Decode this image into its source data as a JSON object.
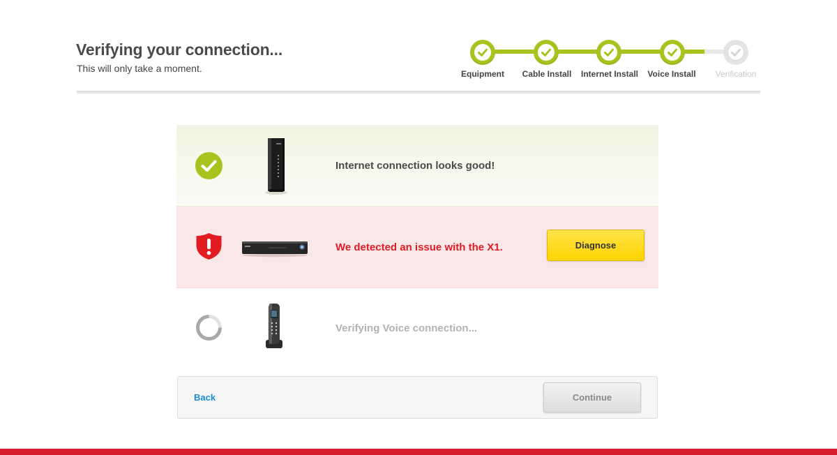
{
  "header": {
    "title": "Verifying your connection...",
    "subtitle": "This will only take a moment."
  },
  "tracker": {
    "steps": [
      {
        "label": "Equipment",
        "status": "done"
      },
      {
        "label": "Cable Install",
        "status": "done"
      },
      {
        "label": "Internet Install",
        "status": "done"
      },
      {
        "label": "Voice Install",
        "status": "done"
      },
      {
        "label": "Verification",
        "status": "todo"
      }
    ]
  },
  "checks": [
    {
      "message": "Internet connection looks good!",
      "status": "success",
      "device": "cable-modem"
    },
    {
      "message": "We detected an issue with the X1.",
      "status": "error",
      "device": "x1-set-top-box",
      "action_label": "Diagnose"
    },
    {
      "message": "Verifying Voice connection...",
      "status": "pending",
      "device": "cordless-phone"
    }
  ],
  "footer": {
    "back_label": "Back",
    "continue_label": "Continue"
  },
  "colors": {
    "accent_green": "#a6c31e",
    "error_red": "#e31b23",
    "brand_red": "#d71c2c",
    "button_yellow": "#ffd300",
    "link_blue": "#1a8bd4"
  }
}
